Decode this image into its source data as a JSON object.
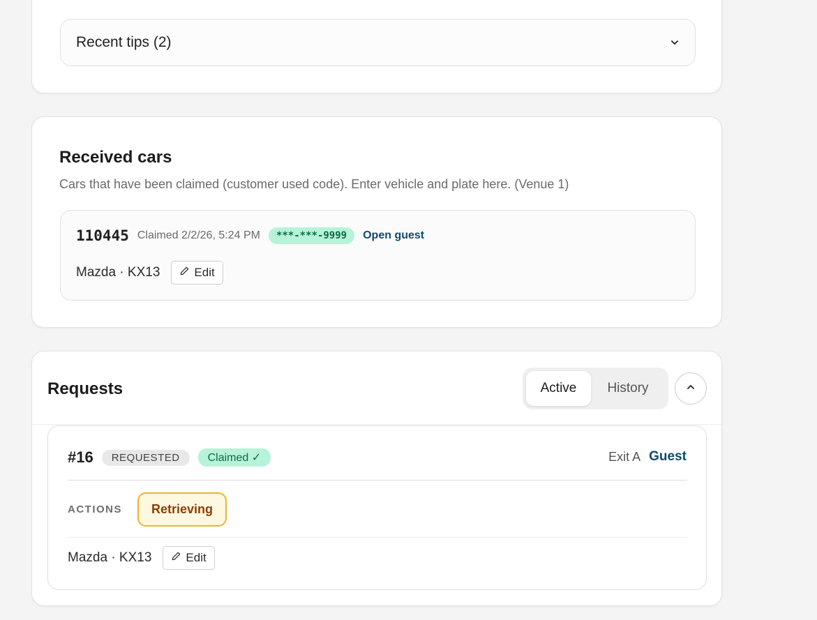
{
  "tips": {
    "label": "Recent tips (2)"
  },
  "received": {
    "title": "Received cars",
    "description": "Cars that have been claimed (customer used code). Enter vehicle and plate here. (Venue 1)",
    "car": {
      "code": "110445",
      "claimed": "Claimed 2/2/26, 5:24 PM",
      "phone": "***-***-9999",
      "open_guest": "Open guest",
      "vehicle": "Mazda · KX13",
      "edit_label": "Edit"
    }
  },
  "requests": {
    "title": "Requests",
    "tabs": [
      {
        "label": "Active",
        "active": true
      },
      {
        "label": "History",
        "active": false
      }
    ],
    "item": {
      "number": "#16",
      "status": "REQUESTED",
      "claimed_badge": "Claimed ✓",
      "exit": "Exit A",
      "guest_link": "Guest",
      "actions_label": "ACTIONS",
      "action_button": "Retrieving",
      "vehicle": "Mazda · KX13",
      "edit_label": "Edit"
    }
  },
  "icons": {
    "tips_toggle": "chevron-down-icon",
    "collapse": "chevron-up-icon",
    "edit": "pencil-icon"
  },
  "colors": {
    "accent_link": "#0f4b6b",
    "claimed_green_bg": "#b6f3d8",
    "claimed_green_text": "#0f6b43",
    "retrieving_border": "#f2b12d",
    "retrieving_text": "#8a3f06"
  }
}
